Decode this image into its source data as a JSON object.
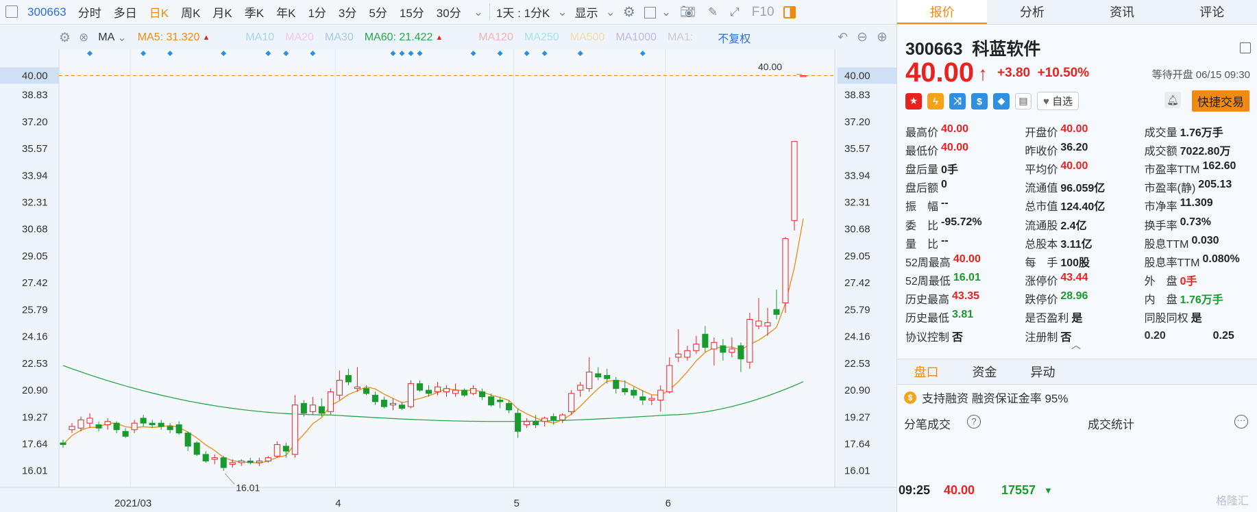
{
  "toolbar": {
    "code": "300663",
    "periods": [
      "分时",
      "多日",
      "日K",
      "周K",
      "月K",
      "季K",
      "年K",
      "1分",
      "3分",
      "5分",
      "15分",
      "30分"
    ],
    "active_period": "日K",
    "range": "1天 : 1分K",
    "display": "显示",
    "f10": "F10"
  },
  "indicators": {
    "name": "MA",
    "ma5": "MA5: 31.320",
    "ma10": "MA10",
    "ma20": "MA20",
    "ma30": "MA30",
    "ma60": "MA60: 21.422",
    "ma120": "MA120",
    "ma250": "MA250",
    "ma500": "MA500",
    "ma1000": "MA1000",
    "ma1": "MA1:",
    "adjust": "不复权"
  },
  "colors": {
    "up": "#e8231f",
    "down": "#1a9a2e",
    "ma5": "#f08a10",
    "ma60": "#2aa64a",
    "accent": "#f08a10",
    "link": "#2f6fd6"
  },
  "chart_data": {
    "type": "candlestick",
    "ylim": [
      15.0,
      41.6
    ],
    "yticks": [
      "40.00",
      "38.83",
      "37.20",
      "35.57",
      "33.94",
      "32.31",
      "30.68",
      "29.05",
      "27.42",
      "25.79",
      "24.16",
      "22.53",
      "20.90",
      "19.27",
      "17.64",
      "16.01"
    ],
    "ytick_values": [
      40.0,
      38.83,
      37.2,
      35.57,
      33.94,
      32.31,
      30.68,
      29.05,
      27.42,
      25.79,
      24.16,
      22.53,
      20.9,
      19.27,
      17.64,
      16.01
    ],
    "xlabels": [
      {
        "label": "2021/03",
        "index": 8
      },
      {
        "label": "4",
        "index": 31
      },
      {
        "label": "5",
        "index": 51
      },
      {
        "label": "6",
        "index": 68
      }
    ],
    "top_label": "40.00",
    "low_label": "16.01",
    "current_price_line": 40.0,
    "candles": [
      [
        17.7,
        17.9,
        17.4,
        17.6
      ],
      [
        18.5,
        18.9,
        18.3,
        18.7
      ],
      [
        18.6,
        19.3,
        18.4,
        19.1
      ],
      [
        18.9,
        19.5,
        18.6,
        19.2
      ],
      [
        18.8,
        19.0,
        18.4,
        18.6
      ],
      [
        18.8,
        19.2,
        18.5,
        19.0
      ],
      [
        18.9,
        19.0,
        18.3,
        18.5
      ],
      [
        18.4,
        18.6,
        18.0,
        18.1
      ],
      [
        18.5,
        19.1,
        18.3,
        18.9
      ],
      [
        19.2,
        19.4,
        18.7,
        18.9
      ],
      [
        18.9,
        19.1,
        18.6,
        18.8
      ],
      [
        18.9,
        19.1,
        18.5,
        18.7
      ],
      [
        18.7,
        18.9,
        18.3,
        18.5
      ],
      [
        18.8,
        19.0,
        18.2,
        18.3
      ],
      [
        18.3,
        18.4,
        17.2,
        17.5
      ],
      [
        17.7,
        17.8,
        16.9,
        17.0
      ],
      [
        17.0,
        17.2,
        16.5,
        16.6
      ],
      [
        16.7,
        17.0,
        16.4,
        16.8
      ],
      [
        16.8,
        16.9,
        16.0,
        16.2
      ],
      [
        16.4,
        16.7,
        16.2,
        16.5
      ],
      [
        16.5,
        16.7,
        16.3,
        16.6
      ],
      [
        16.6,
        16.8,
        16.4,
        16.5
      ],
      [
        16.5,
        16.8,
        16.3,
        16.6
      ],
      [
        16.6,
        16.9,
        16.5,
        16.8
      ],
      [
        16.9,
        17.8,
        16.8,
        17.6
      ],
      [
        17.5,
        17.7,
        16.8,
        17.2
      ],
      [
        17.0,
        20.6,
        16.8,
        20.0
      ],
      [
        20.1,
        20.3,
        19.3,
        19.5
      ],
      [
        19.6,
        20.5,
        19.4,
        20.0
      ],
      [
        19.9,
        20.4,
        19.3,
        19.5
      ],
      [
        19.6,
        21.0,
        19.4,
        20.8
      ],
      [
        20.6,
        22.1,
        20.3,
        21.5
      ],
      [
        21.8,
        22.2,
        21.2,
        21.4
      ],
      [
        21.0,
        22.3,
        20.8,
        21.1
      ],
      [
        21.0,
        21.2,
        20.6,
        20.7
      ],
      [
        20.6,
        20.8,
        20.0,
        20.2
      ],
      [
        20.3,
        20.5,
        19.8,
        19.9
      ],
      [
        20.0,
        20.4,
        19.7,
        20.1
      ],
      [
        20.0,
        20.2,
        19.7,
        19.8
      ],
      [
        19.9,
        21.5,
        19.8,
        21.3
      ],
      [
        21.3,
        21.5,
        20.8,
        20.9
      ],
      [
        20.9,
        21.2,
        20.5,
        20.7
      ],
      [
        20.8,
        21.4,
        20.6,
        21.1
      ],
      [
        20.8,
        21.2,
        20.5,
        21.0
      ],
      [
        20.7,
        21.3,
        20.5,
        20.9
      ],
      [
        20.9,
        21.0,
        20.5,
        20.6
      ],
      [
        20.7,
        21.2,
        20.6,
        21.0
      ],
      [
        20.8,
        21.0,
        20.3,
        20.5
      ],
      [
        20.5,
        20.7,
        19.9,
        20.0
      ],
      [
        20.3,
        20.5,
        19.8,
        20.2
      ],
      [
        20.1,
        20.3,
        19.5,
        19.7
      ],
      [
        19.5,
        19.8,
        18.0,
        18.4
      ],
      [
        18.8,
        19.2,
        18.6,
        19.0
      ],
      [
        19.0,
        19.4,
        18.6,
        18.8
      ],
      [
        19.0,
        19.3,
        18.7,
        19.2
      ],
      [
        19.3,
        19.5,
        18.8,
        19.1
      ],
      [
        19.1,
        19.5,
        18.9,
        19.4
      ],
      [
        19.6,
        20.9,
        19.4,
        20.7
      ],
      [
        20.9,
        21.4,
        20.5,
        21.2
      ],
      [
        21.0,
        22.9,
        20.8,
        22.0
      ],
      [
        21.9,
        22.3,
        21.5,
        21.7
      ],
      [
        21.8,
        22.2,
        21.3,
        21.6
      ],
      [
        21.5,
        21.7,
        20.7,
        21.0
      ],
      [
        21.0,
        21.5,
        20.6,
        20.8
      ],
      [
        20.9,
        21.1,
        20.4,
        20.6
      ],
      [
        20.5,
        20.9,
        20.0,
        20.3
      ],
      [
        20.3,
        20.6,
        20.0,
        20.4
      ],
      [
        20.3,
        21.2,
        19.6,
        20.9
      ],
      [
        20.8,
        22.9,
        20.7,
        22.4
      ],
      [
        22.9,
        24.6,
        22.6,
        23.1
      ],
      [
        22.9,
        23.6,
        22.7,
        23.3
      ],
      [
        23.3,
        24.2,
        23.1,
        23.7
      ],
      [
        24.3,
        24.8,
        23.2,
        23.5
      ],
      [
        23.4,
        24.1,
        22.4,
        23.8
      ],
      [
        23.6,
        24.0,
        22.7,
        23.2
      ],
      [
        23.2,
        24.1,
        22.9,
        23.4
      ],
      [
        23.6,
        23.8,
        22.0,
        22.8
      ],
      [
        22.6,
        25.6,
        22.2,
        25.2
      ],
      [
        24.8,
        26.5,
        24.6,
        25.1
      ],
      [
        24.8,
        25.9,
        24.2,
        25.0
      ],
      [
        25.8,
        27.0,
        25.2,
        25.5
      ],
      [
        26.2,
        30.2,
        25.6,
        30.1
      ],
      [
        31.2,
        36.0,
        30.6,
        36.0
      ],
      [
        40.0,
        40.0,
        40.0,
        40.0
      ]
    ]
  },
  "panel": {
    "tabs": [
      "报价",
      "分析",
      "资讯",
      "评论"
    ],
    "active_tab": "报价",
    "code": "300663",
    "name": "科蓝软件",
    "price": "40.00",
    "change": "+3.80",
    "change_pct": "+10.50%",
    "status": "等待开盘 06/15 09:30",
    "watch_label": "自选",
    "quick_trade": "快捷交易",
    "quote_rows": [
      [
        {
          "l": "最高价",
          "v": "40.00",
          "c": "red"
        },
        {
          "l": "开盘价",
          "v": "40.00",
          "c": "red"
        },
        {
          "l": "成交量",
          "v": "1.76万手",
          "c": ""
        }
      ],
      [
        {
          "l": "最低价",
          "v": "40.00",
          "c": "red"
        },
        {
          "l": "昨收价",
          "v": "36.20",
          "c": ""
        },
        {
          "l": "成交额",
          "v": "7022.80万",
          "c": ""
        }
      ],
      [
        {
          "l": "盘后量",
          "v": "0手",
          "c": ""
        },
        {
          "l": "平均价",
          "v": "40.00",
          "c": "red"
        },
        {
          "l": "市盈率TTM",
          "v": "162.60",
          "c": ""
        }
      ],
      [
        {
          "l": "盘后额",
          "v": "0",
          "c": ""
        },
        {
          "l": "流通值",
          "v": "96.059亿",
          "c": ""
        },
        {
          "l": "市盈率(静)",
          "v": "205.13",
          "c": ""
        }
      ],
      [
        {
          "l": "振　幅",
          "v": "--",
          "c": ""
        },
        {
          "l": "总市值",
          "v": "124.40亿",
          "c": ""
        },
        {
          "l": "市净率",
          "v": "11.309",
          "c": ""
        }
      ],
      [
        {
          "l": "委　比",
          "v": "-95.72%",
          "c": ""
        },
        {
          "l": "流通股",
          "v": "2.4亿",
          "c": ""
        },
        {
          "l": "换手率",
          "v": "0.73%",
          "c": ""
        }
      ],
      [
        {
          "l": "量　比",
          "v": "--",
          "c": ""
        },
        {
          "l": "总股本",
          "v": "3.11亿",
          "c": ""
        },
        {
          "l": "股息TTM",
          "v": "0.030",
          "c": ""
        }
      ],
      [
        {
          "l": "52周最高",
          "v": "40.00",
          "c": "red"
        },
        {
          "l": "每　手",
          "v": "100股",
          "c": ""
        },
        {
          "l": "股息率TTM",
          "v": "0.080%",
          "c": ""
        }
      ],
      [
        {
          "l": "52周最低",
          "v": "16.01",
          "c": "green"
        },
        {
          "l": "涨停价",
          "v": "43.44",
          "c": "red"
        },
        {
          "l": "外　盘",
          "v": "0手",
          "c": "red"
        }
      ],
      [
        {
          "l": "历史最高",
          "v": "43.35",
          "c": "red"
        },
        {
          "l": "跌停价",
          "v": "28.96",
          "c": "green"
        },
        {
          "l": "内　盘",
          "v": "1.76万手",
          "c": "green"
        }
      ],
      [
        {
          "l": "历史最低",
          "v": "3.81",
          "c": "green"
        },
        {
          "l": "是否盈利",
          "v": "是",
          "c": ""
        },
        {
          "l": "同股同权",
          "v": "是",
          "c": ""
        }
      ],
      [
        {
          "l": "协议控制",
          "v": "否",
          "c": ""
        },
        {
          "l": "注册制",
          "v": "否",
          "c": ""
        },
        {
          "l": "0.20",
          "v": "0.25",
          "c": ""
        }
      ]
    ],
    "subtabs": [
      "盘口",
      "资金",
      "异动"
    ],
    "active_subtab": "盘口",
    "margin_text": "支持融资 融资保证金率 95%",
    "trade_title": "分笔成交",
    "trade_stats": "成交统计",
    "trade": {
      "time": "09:25",
      "price": "40.00",
      "vol": "17557"
    },
    "watermark": "格隆汇"
  }
}
